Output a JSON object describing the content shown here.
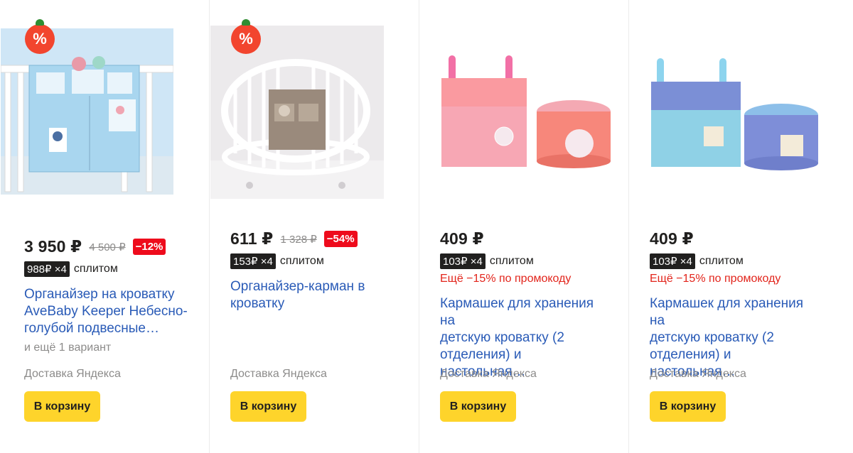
{
  "products": [
    {
      "price": "3 950 ₽",
      "old_price": "4 500 ₽",
      "discount": "−12%",
      "split_tag": "988₽ ×4",
      "split_label": "сплитом",
      "title_line1": "Органайзер на кроватку",
      "title_line2": "AveBaby Keeper Небесно-",
      "title_line3": "голубой подвесные…",
      "variants": "и ещё 1 вариант",
      "delivery": "Доставка Яндекса",
      "cart": "В корзину",
      "sale_badge": "%"
    },
    {
      "price": "611 ₽",
      "old_price": "1 328 ₽",
      "discount": "−54%",
      "split_tag": "153₽ ×4",
      "split_label": "сплитом",
      "title_line1": "Органайзер-карман в",
      "title_line2": "кроватку",
      "delivery": "Доставка Яндекса",
      "cart": "В корзину",
      "sale_badge": "%"
    },
    {
      "price": "409 ₽",
      "split_tag": "103₽ ×4",
      "split_label": "сплитом",
      "promo": "Ещё −15% по промокоду",
      "title_line1": "Кармашек для хранения на",
      "title_line2": "детскую кроватку (2",
      "title_line3": "отделения) и настольная…",
      "delivery": "Доставка Яндекса",
      "cart": "В корзину"
    },
    {
      "price": "409 ₽",
      "split_tag": "103₽ ×4",
      "split_label": "сплитом",
      "promo": "Ещё −15% по промокоду",
      "title_line1": "Кармашек для хранения на",
      "title_line2": "детскую кроватку (2",
      "title_line3": "отделения) и настольная…",
      "delivery": "Доставка Яндекса",
      "cart": "В корзину"
    }
  ],
  "colors": {
    "accent_yellow": "#fed42b",
    "link_blue": "#2a5bb7",
    "discount_red": "#ee0b1c",
    "promo_red": "#e2241b"
  }
}
